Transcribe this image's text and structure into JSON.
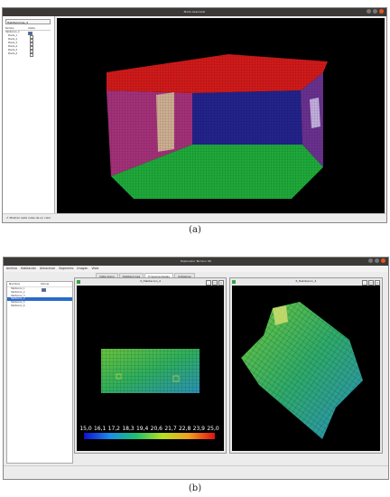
{
  "figure_a": {
    "window_title": "Modo Avanzado",
    "combo_value": "Habitaciones_4",
    "columns": [
      "Nombre",
      "Visible"
    ],
    "tree_root": "Habitacion_4",
    "tree_items": [
      "Planta_1",
      "Planta_2",
      "Planta_3",
      "Planta_4",
      "Planta_5",
      "Planta_6"
    ],
    "status_text": "Mostrar cada nube de un color",
    "caption": "(a)"
  },
  "figure_b": {
    "window_title": "Explorador Térmico 3D",
    "menu": [
      "Archivo",
      "Habitación",
      "Almacenar",
      "Segmento",
      "Imagen",
      "Vista"
    ],
    "tabs": [
      "Vista plano",
      "Habitaciones",
      "H.Segmentadas",
      "Imágenes"
    ],
    "active_tab": "H.Segmentadas",
    "columns": [
      "Nombre",
      "Ubicar"
    ],
    "tree_items": [
      "Habitacion_1",
      "Habitacion_2",
      "Habitacion_3",
      "Habitacion_4",
      "Habitacion_5",
      "Habitacion_6"
    ],
    "selected_item": "Habitacion_4",
    "pane1_title": "3_Habitacion_4",
    "pane2_title": "6_Habitacion_4",
    "colorbar_ticks": [
      "15,0",
      "16,1",
      "17,2",
      "18,3",
      "19,4",
      "20,6",
      "21,7",
      "22,8",
      "23,9",
      "25,0"
    ],
    "caption": "(b)"
  },
  "colors": {
    "title_bar": "#3b3a37",
    "close_button": "#e95420",
    "selection": "#2a6acb",
    "viewport_bg": "#000000"
  }
}
